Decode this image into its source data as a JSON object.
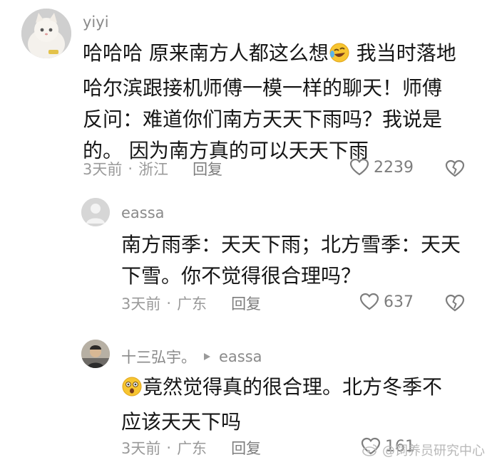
{
  "comments": [
    {
      "username": "yiyi",
      "text_before_emoji": "哈哈哈 原来南方人都这么想",
      "emoji": "rolling-on-floor-laughing-emoji",
      "text_line1_tail": " 我当时落地",
      "text_lines": [
        "哈尔滨跟接机师傅一模一样的聊天！师傅",
        "反问：难道你们南方天天下雨吗？我说是",
        "的。 因为南方真的可以天天下雨"
      ],
      "time": "3天前",
      "location": "浙江",
      "reply_label": "回复",
      "likes": "2239"
    },
    {
      "username": "eassa",
      "text_lines": [
        "南方雨季：天天下雨；北方雪季：天天",
        "下雪。你不觉得很合理吗？"
      ],
      "time": "3天前",
      "location": "广东",
      "reply_label": "回复",
      "likes": "637"
    },
    {
      "username": "十三弘宇。",
      "reply_to": "eassa",
      "emoji": "astonished-face-emoji",
      "text_line1": "竟然觉得真的很合理。北方冬季不",
      "text_line2": "应该天天下吗",
      "time": "3天前",
      "location": "广东",
      "reply_label": "回复",
      "likes": "161"
    }
  ],
  "watermark": "@饲养员研究中心",
  "colors": {
    "text": "#161616",
    "meta": "#9a9a9a",
    "icon": "#7d7d7d"
  }
}
